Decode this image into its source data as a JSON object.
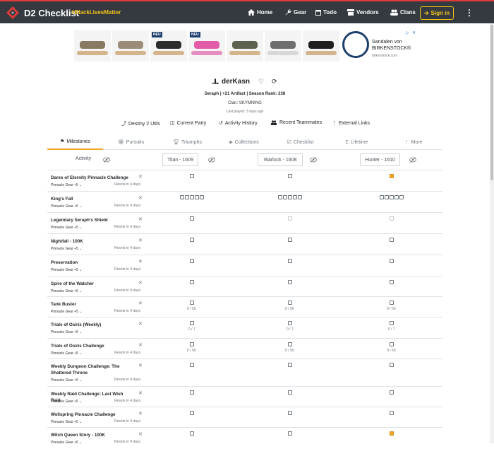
{
  "nav": {
    "brand": "D2 Checklist",
    "hashtag": "#BlackLivesMatter",
    "items": [
      {
        "label": "Home",
        "icon": "home-icon"
      },
      {
        "label": "Gear",
        "icon": "wrench-icon"
      },
      {
        "label": "Todo",
        "icon": "calendar-icon"
      },
      {
        "label": "Vendors",
        "icon": "store-icon"
      },
      {
        "label": "Clans",
        "icon": "users-icon"
      }
    ],
    "signin": "Sign in",
    "more": "⋮"
  },
  "ad": {
    "badges": [
      "NEU",
      "NEU"
    ],
    "title_line1": "Sandalen von",
    "title_line2": "BIRKENSTOCK®",
    "source": "birkenstock.com"
  },
  "profile": {
    "name": "derKasn",
    "stats": "Seraph | +21 Artifact | Season Rank: 238",
    "clan": "Clan: SKYMNING",
    "last_played": "Last played: 3 days ago"
  },
  "links": [
    {
      "label": "Destiny 2 Utils"
    },
    {
      "label": "Current Party"
    },
    {
      "label": "Activity History"
    },
    {
      "label": "Recent Teammates"
    },
    {
      "label": "External Links"
    }
  ],
  "tabs": [
    "Milestones",
    "Pursuits",
    "Triumphs",
    "Collections",
    "Checklist",
    "Lifetime",
    "More"
  ],
  "table": {
    "activity_header": "Activity",
    "characters": [
      "Titan - 1609",
      "Warlock - 1608",
      "Hunter - 1610"
    ],
    "rows": [
      {
        "title": "Dares of Eternity Pinnacle Challenge",
        "sub": "Pinnacle Gear +5 ⌄",
        "reset": "Resets in 4 days"
      },
      {
        "title": "King's Fall",
        "sub": "Pinnacle Gear +5 ⌄",
        "reset": "Resets in 4 days"
      },
      {
        "title": "Legendary Seraph's Shield",
        "sub": "Pinnacle Gear +5 ⌄",
        "reset": "Resets in 4 days"
      },
      {
        "title": "Nightfall - 100K",
        "sub": "Pinnacle Gear +5 ⌄",
        "reset": "Resets in 4 days"
      },
      {
        "title": "Preservation",
        "sub": "Pinnacle Gear +5 ⌄",
        "reset": "Resets in 4 days"
      },
      {
        "title": "Spire of the Watcher",
        "sub": "Pinnacle Gear +5 ⌄",
        "reset": "Resets in 4 days"
      },
      {
        "title": "Tank Buster",
        "sub": "Pinnacle Gear +5 ⌄",
        "reset": "Resets in 4 days",
        "progress": [
          "0 / 50",
          "0 / 50",
          "0 / 50"
        ]
      },
      {
        "title": "Trials of Osiris (Weekly)",
        "sub": "Pinnacle Gear +5 ⌄",
        "reset": "",
        "progress": [
          "0 / 7",
          "0 / 7",
          "0 / 7"
        ]
      },
      {
        "title": "Trials of Osiris Challenge",
        "sub": "Pinnacle Gear +5 ⌄",
        "reset": "Resets in 4 days",
        "progress": [
          "0 / 50",
          "0 / 50",
          "0 / 50"
        ]
      },
      {
        "title": "Weekly Dungeon Challenge: The Shattered Throne",
        "sub": "Pinnacle Gear +5 ⌄",
        "reset": "Resets in 4 days"
      },
      {
        "title": "Weekly Raid Challenge: Last Wish Raid",
        "sub": "Pinnacle Gear +5 ⌄",
        "reset": "Resets in 4 days"
      },
      {
        "title": "Wellspring Pinnacle Challenge",
        "sub": "Pinnacle Gear +5 ⌄",
        "reset": "Resets in 4 days"
      },
      {
        "title": "Witch Queen Story - 100K",
        "sub": "Pinnacle Gear +5 ⌄",
        "reset": "Resets in 4 days"
      }
    ]
  },
  "colors": {
    "accent": "#f5a623",
    "navbar": "#343a40",
    "brand_red": "#e03a3a",
    "signin": "#f5c518"
  }
}
